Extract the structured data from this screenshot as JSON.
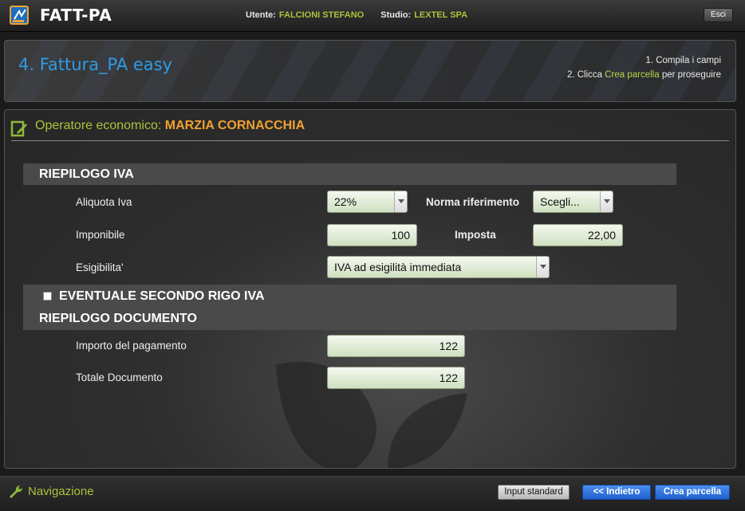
{
  "topbar": {
    "app_name": "FATT-PA",
    "user_label": "Utente:",
    "user_value": "FALCIONI STEFANO",
    "studio_label": "Studio:",
    "studio_value": "LEXTEL SPA",
    "exit_label": "Esci"
  },
  "header": {
    "title": "4. Fattura_PA easy",
    "step1": "1. Compila i campi",
    "step2_prefix": "2. Clicca ",
    "step2_highlight": "Crea parcella",
    "step2_suffix": " per proseguire"
  },
  "operator": {
    "label": "Operatore economico:",
    "name": "MARZIA CORNACCHIA"
  },
  "riepilogo_iva": {
    "title": "RIEPILOGO IVA",
    "aliquota_label": "Aliquota Iva",
    "aliquota_value": "22%",
    "norma_label": "Norma riferimento",
    "norma_value": "Scegli...",
    "imponibile_label": "Imponibile",
    "imponibile_value": "100",
    "imposta_label": "Imposta",
    "imposta_value": "22,00",
    "esigibilita_label": "Esigibilita'",
    "esigibilita_value": "IVA ad esigilità immediata"
  },
  "secondo_rigo": {
    "label": "EVENTUALE SECONDO RIGO IVA",
    "checked": false
  },
  "riepilogo_documento": {
    "title": "RIEPILOGO DOCUMENTO",
    "importo_label": "Importo del pagamento",
    "importo_value": "122",
    "totale_label": "Totale Documento",
    "totale_value": "122"
  },
  "bottombar": {
    "nav_label": "Navigazione",
    "input_standard": "Input standard",
    "indietro": "<< Indietro",
    "crea_parcella": "Crea parcella"
  },
  "colors": {
    "accent_green": "#a8c43a",
    "accent_orange": "#f0a230",
    "title_blue": "#2f9be6",
    "button_blue": "#1f5fcc"
  }
}
